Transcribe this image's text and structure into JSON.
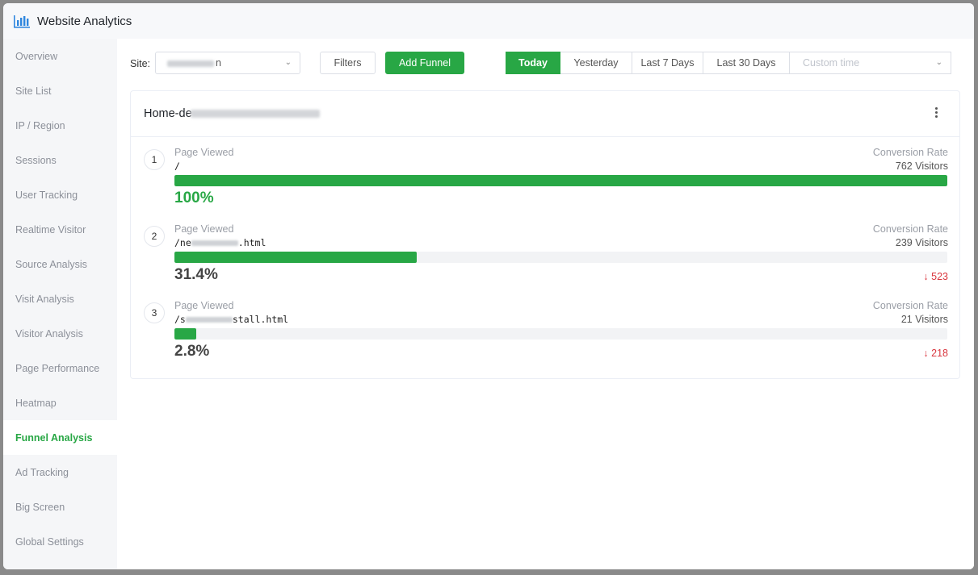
{
  "app": {
    "title": "Website Analytics",
    "accent_color": "#28a745",
    "logo_icon": "bar-chart-icon"
  },
  "sidebar": {
    "items": [
      {
        "label": "Overview",
        "active": false
      },
      {
        "label": "Site List",
        "active": false
      },
      {
        "label": "IP / Region",
        "active": false
      },
      {
        "label": "Sessions",
        "active": false
      },
      {
        "label": "User Tracking",
        "active": false
      },
      {
        "label": "Realtime Visitor",
        "active": false
      },
      {
        "label": "Source Analysis",
        "active": false
      },
      {
        "label": "Visit Analysis",
        "active": false
      },
      {
        "label": "Visitor Analysis",
        "active": false
      },
      {
        "label": "Page Performance",
        "active": false
      },
      {
        "label": "Heatmap",
        "active": false
      },
      {
        "label": "Funnel Analysis",
        "active": true
      },
      {
        "label": "Ad Tracking",
        "active": false
      },
      {
        "label": "Big Screen",
        "active": false
      },
      {
        "label": "Global Settings",
        "active": false
      }
    ]
  },
  "toolbar": {
    "site_label": "Site:",
    "site_value_suffix": "n",
    "filters_label": "Filters",
    "add_funnel_label": "Add Funnel",
    "date_ranges": [
      {
        "label": "Today",
        "active": true
      },
      {
        "label": "Yesterday",
        "active": false
      },
      {
        "label": "Last 7 Days",
        "active": false
      },
      {
        "label": "Last 30 Days",
        "active": false
      }
    ],
    "custom_time_placeholder": "Custom time"
  },
  "funnel": {
    "title_visible": "Home-de",
    "steps": [
      {
        "number": "1",
        "label": "Page Viewed",
        "path_prefix": "/",
        "path_suffix": "",
        "rate_label": "Conversion Rate",
        "visitors": "762 Visitors",
        "percent": "100%",
        "fraction": 1.0,
        "drop": ""
      },
      {
        "number": "2",
        "label": "Page Viewed",
        "path_prefix": "/ne",
        "path_suffix": ".html",
        "rate_label": "Conversion Rate",
        "visitors": "239 Visitors",
        "percent": "31.4%",
        "fraction": 0.314,
        "drop": "523"
      },
      {
        "number": "3",
        "label": "Page Viewed",
        "path_prefix": "/s",
        "path_suffix": "stall.html",
        "rate_label": "Conversion Rate",
        "visitors": "21 Visitors",
        "percent": "2.8%",
        "fraction": 0.028,
        "drop": "218"
      }
    ]
  }
}
